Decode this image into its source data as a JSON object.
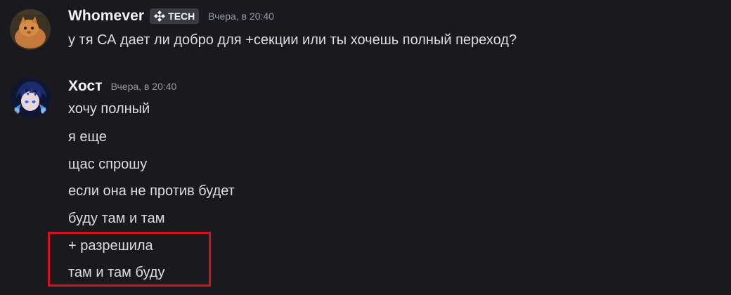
{
  "messages": [
    {
      "author": "Whomever",
      "tag": "TECH",
      "timestamp": "Вчера, в 20:40",
      "lines": [
        "у тя СА дает ли добро для +секции или ты хочешь полный переход?"
      ]
    },
    {
      "author": "Хост",
      "timestamp": "Вчера, в 20:40",
      "lines": [
        "хочу полный",
        "я еще",
        "щас спрошу",
        "если она не против будет",
        "буду там и там",
        "+ разрешила",
        "там и там буду"
      ]
    }
  ],
  "colors": {
    "background": "#1a1a1e",
    "username": "#f2f3f5",
    "text": "#dbdee1",
    "timestamp": "#949ba4",
    "highlight_border": "#d3121b"
  },
  "icons": {
    "tag_icon": "diamond-cross-icon"
  }
}
